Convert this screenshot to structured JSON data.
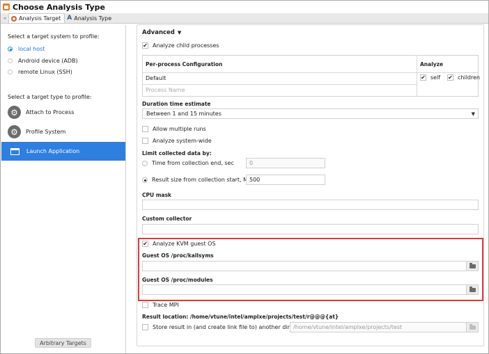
{
  "window": {
    "title": "Choose Analysis Type"
  },
  "tabs": [
    {
      "label": "Analysis Target",
      "active": true
    },
    {
      "label": "Analysis Type",
      "active": false
    }
  ],
  "left": {
    "system_heading": "Select a target system to profile:",
    "systems": [
      {
        "label": "local host",
        "selected": true
      },
      {
        "label": "Android device (ADB)",
        "selected": false
      },
      {
        "label": "remote Linux (SSH)",
        "selected": false
      }
    ],
    "type_heading": "Select a target type to profile:",
    "types": [
      {
        "label": "Attach to Process",
        "icon": "gear-icon"
      },
      {
        "label": "Profile System",
        "icon": "gears-icon"
      },
      {
        "label": "Launch Application",
        "icon": "window-icon",
        "selected": true
      }
    ],
    "arbitrary_button": "Arbitrary Targets"
  },
  "right": {
    "advanced_label": "Advanced",
    "analyze_child": {
      "label": "Analyze child processes",
      "checked": true
    },
    "table": {
      "col_config": "Per-process Configuration",
      "col_analyze": "Analyze",
      "row_default": "Default",
      "self_label": "self",
      "children_label": "children",
      "process_placeholder": "Process Name"
    },
    "duration": {
      "label": "Duration time estimate",
      "value": "Between 1 and 15 minutes"
    },
    "allow_multiple": {
      "label": "Allow multiple runs",
      "checked": false
    },
    "system_wide": {
      "label": "Analyze system-wide",
      "checked": false
    },
    "limit": {
      "label": "Limit collected data by:",
      "time_label": "Time from collection end, sec",
      "time_value": "0",
      "size_label": "Result size from collection start, MB",
      "size_value": "500"
    },
    "cpu_mask": {
      "label": "CPU mask",
      "value": ""
    },
    "custom_collector": {
      "label": "Custom collector",
      "value": ""
    },
    "kvm": {
      "label": "Analyze KVM guest OS",
      "checked": true
    },
    "kallsyms": {
      "label": "Guest OS /proc/kallsyms",
      "value": ""
    },
    "modules": {
      "label": "Guest OS /proc/modules",
      "value": ""
    },
    "trace_mpi": {
      "label": "Trace MPI",
      "checked": false
    },
    "result_location": "Result location: /home/vtune/intel/amplxe/projects/test/r@@@{at}",
    "store_result": {
      "label": "Store result in (and create link file to) another directory",
      "value": "/home/vtune/intel/amplxe/projects/test",
      "checked": false
    }
  },
  "colors": {
    "accent": "#2f7fe0",
    "highlight_border": "#d83b3b",
    "link_blue": "#1d77c9"
  }
}
